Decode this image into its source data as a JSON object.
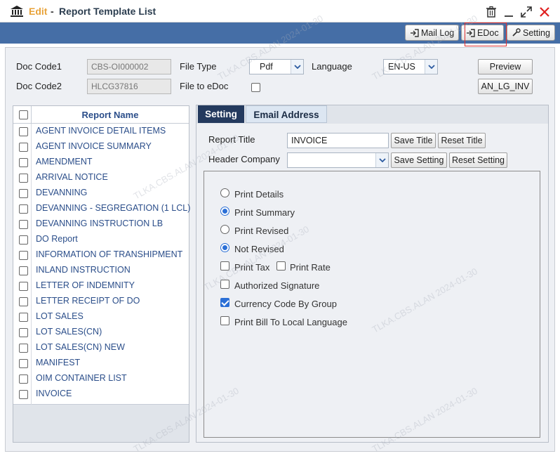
{
  "window": {
    "mode": "Edit",
    "separator": "-",
    "title": "Report Template List"
  },
  "toolbar": {
    "mail_log": "Mail Log",
    "edoc": "EDoc",
    "setting": "Setting"
  },
  "form": {
    "doc_code1_label": "Doc Code1",
    "doc_code1_value": "CBS-OI000002",
    "doc_code2_label": "Doc Code2",
    "doc_code2_value": "HLCG37816",
    "file_type_label": "File Type",
    "file_type_value": "Pdf",
    "file_to_edoc_label": "File to eDoc",
    "language_label": "Language",
    "language_value": "EN-US",
    "preview_button": "Preview",
    "template_button": "AN_LG_INV"
  },
  "report_list": {
    "header": "Report Name",
    "items": [
      "AGENT INVOICE DETAIL ITEMS",
      "AGENT INVOICE SUMMARY",
      "AMENDMENT",
      "ARRIVAL NOTICE",
      "DEVANNING",
      "DEVANNING - SEGREGATION (1 LCL)",
      "DEVANNING INSTRUCTION LB",
      "DO Report",
      "INFORMATION OF TRANSHIPMENT",
      "INLAND INSTRUCTION",
      "LETTER OF INDEMNITY",
      "LETTER RECEIPT OF DO",
      "LOT SALES",
      "LOT SALES(CN)",
      "LOT SALES(CN) NEW",
      "MANIFEST",
      "OIM CONTAINER LIST",
      "INVOICE"
    ]
  },
  "tabs": {
    "setting": "Setting",
    "email": "Email Address"
  },
  "setting": {
    "report_title_label": "Report Title",
    "report_title_value": "INVOICE",
    "save_title": "Save Title",
    "reset_title": "Reset Title",
    "header_company_label": "Header Company",
    "header_company_value": "",
    "save_setting": "Save Setting",
    "reset_setting": "Reset Setting",
    "options": {
      "print_details": "Print Details",
      "print_summary": "Print Summary",
      "print_revised": "Print Revised",
      "not_revised": "Not Revised",
      "print_tax": "Print Tax",
      "print_rate": "Print Rate",
      "authorized_signature": "Authorized Signature",
      "currency_code_by_group": "Currency Code By Group",
      "print_bill_local_language": "Print Bill To Local Language"
    }
  },
  "watermark": "TLKA.CBS.ALAN 2024-01-30",
  "colors": {
    "accent_blue": "#456ea6",
    "edit_orange": "#e8a33a",
    "tab_active": "#243a5e",
    "check_blue": "#2b6fd6",
    "highlight_red": "#e03030"
  }
}
